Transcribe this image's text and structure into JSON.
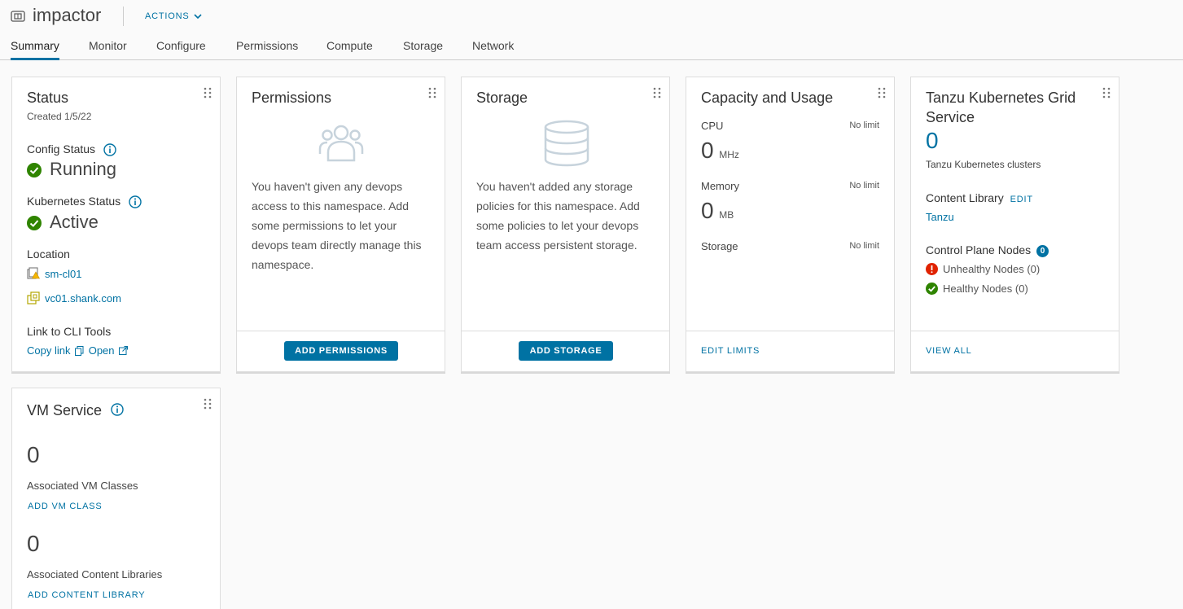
{
  "header": {
    "title": "impactor",
    "actions_label": "ACTIONS"
  },
  "tabs": [
    "Summary",
    "Monitor",
    "Configure",
    "Permissions",
    "Compute",
    "Storage",
    "Network"
  ],
  "status_card": {
    "title": "Status",
    "created": "Created 1/5/22",
    "config_status_label": "Config Status",
    "config_status_value": "Running",
    "k8s_status_label": "Kubernetes Status",
    "k8s_status_value": "Active",
    "location_label": "Location",
    "cluster_link": "sm-cl01",
    "vcenter_link": "vc01.shank.com",
    "cli_label": "Link to CLI Tools",
    "copy_link": "Copy link",
    "open_link": "Open"
  },
  "permissions_card": {
    "title": "Permissions",
    "message": "You haven't given any devops access to this namespace. Add some permissions to let your devops team directly manage this namespace.",
    "button": "ADD PERMISSIONS"
  },
  "storage_card": {
    "title": "Storage",
    "message": "You haven't added any storage policies for this namespace. Add some policies to let your devops team access persistent storage.",
    "button": "ADD STORAGE"
  },
  "capacity_card": {
    "title": "Capacity and Usage",
    "cpu_label": "CPU",
    "cpu_limit": "No limit",
    "cpu_value": "0",
    "cpu_unit": "MHz",
    "memory_label": "Memory",
    "memory_limit": "No limit",
    "memory_value": "0",
    "memory_unit": "MB",
    "storage_label": "Storage",
    "storage_limit": "No limit",
    "footer_link": "EDIT LIMITS"
  },
  "tkg_card": {
    "title": "Tanzu Kubernetes Grid Service",
    "cluster_count": "0",
    "clusters_label": "Tanzu Kubernetes clusters",
    "content_library_label": "Content Library",
    "edit_label": "EDIT",
    "content_library_value": "Tanzu",
    "control_plane_label": "Control Plane Nodes",
    "control_plane_count": "0",
    "unhealthy_label": "Unhealthy Nodes (0)",
    "healthy_label": "Healthy Nodes (0)",
    "footer_link": "VIEW ALL"
  },
  "vm_service_card": {
    "title": "VM Service",
    "vm_classes_count": "0",
    "vm_classes_label": "Associated VM Classes",
    "add_vm_class": "ADD VM CLASS",
    "content_libraries_count": "0",
    "content_libraries_label": "Associated Content Libraries",
    "add_content_library": "ADD CONTENT LIBRARY"
  },
  "colors": {
    "accent": "#0072a3",
    "success": "#2f8400",
    "danger": "#e02200",
    "icon_muted": "#c7d3dc"
  }
}
